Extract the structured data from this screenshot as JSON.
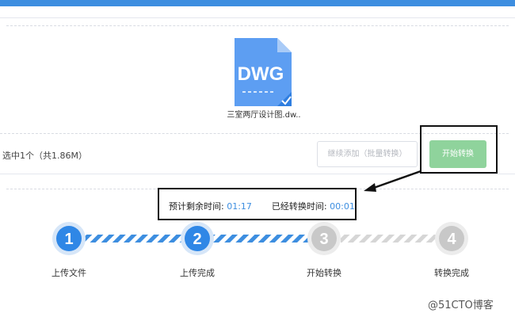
{
  "file": {
    "icon_text": "DWG",
    "icon_name": "dwg-file-icon",
    "name": "三室两厅设计图.dw..",
    "selected": true
  },
  "summary": {
    "selected_info": "选中1个（共1.86M）"
  },
  "buttons": {
    "add_more": "继续添加（批量转换）",
    "start": "开始转换"
  },
  "timer": {
    "remaining_label": "预计剩余时间:",
    "remaining_value": "01:17",
    "elapsed_label": "已经转换时间:",
    "elapsed_value": "00:01"
  },
  "steps": [
    {
      "number": "1",
      "label": "上传文件",
      "state": "done"
    },
    {
      "number": "2",
      "label": "上传完成",
      "state": "done"
    },
    {
      "number": "3",
      "label": "开始转换",
      "state": "pending"
    },
    {
      "number": "4",
      "label": "转换完成",
      "state": "pending"
    }
  ],
  "watermark": "@51CTO博客",
  "colors": {
    "accent": "#3d8ee0",
    "start_button": "#8fd39c",
    "file_icon": "#5d9ef2",
    "pending": "#c8c8c8"
  }
}
